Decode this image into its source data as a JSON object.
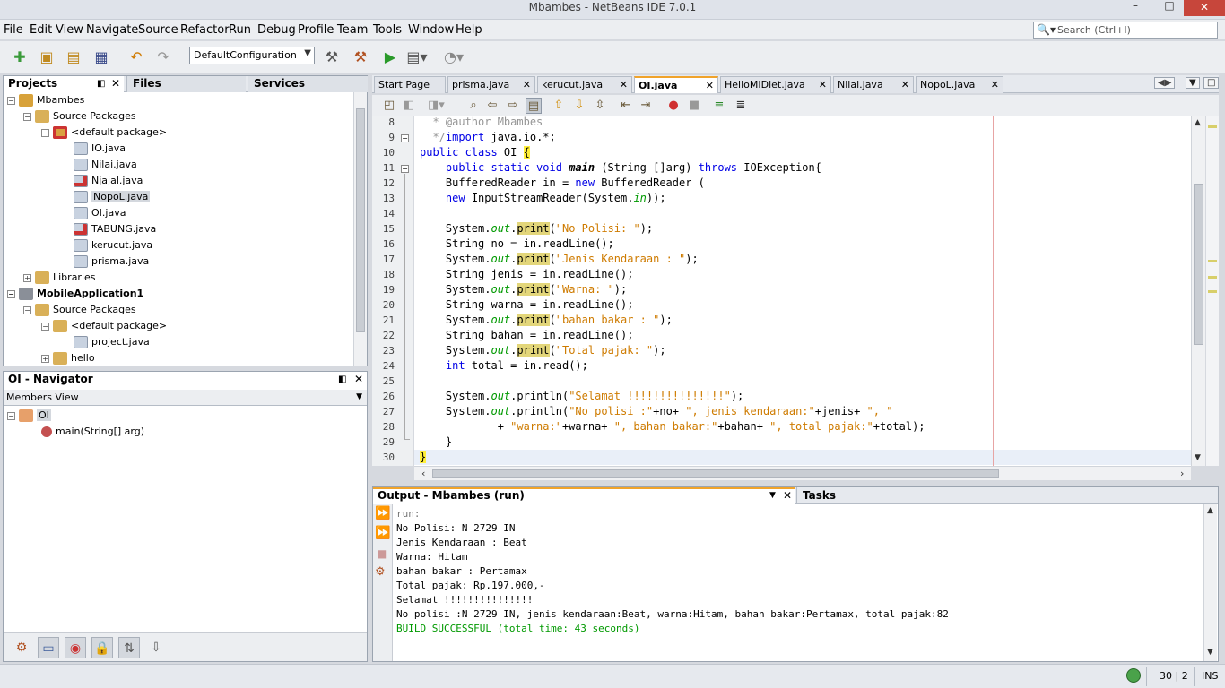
{
  "window": {
    "title": "Mbambes - NetBeans IDE 7.0.1"
  },
  "menu": [
    "File",
    "Edit",
    "View",
    "Navigate",
    "Source",
    "Refactor",
    "Run",
    "Debug",
    "Profile",
    "Team",
    "Tools",
    "Window",
    "Help"
  ],
  "search": {
    "placeholder": "Search (Ctrl+I)"
  },
  "toolbar": {
    "config": "DefaultConfiguration"
  },
  "projects_panel": {
    "tabs": [
      "Projects",
      "Files",
      "Services"
    ],
    "tree": [
      {
        "label": "Mbambes",
        "depth": 0,
        "bold": false
      },
      {
        "label": "Source Packages",
        "depth": 1
      },
      {
        "label": "<default package>",
        "depth": 2
      },
      {
        "label": "IO.java",
        "depth": 3
      },
      {
        "label": "Nilai.java",
        "depth": 3
      },
      {
        "label": "Njajal.java",
        "depth": 3
      },
      {
        "label": "NopoL.java",
        "depth": 3
      },
      {
        "label": "OI.java",
        "depth": 3
      },
      {
        "label": "TABUNG.java",
        "depth": 3
      },
      {
        "label": "kerucut.java",
        "depth": 3
      },
      {
        "label": "prisma.java",
        "depth": 3
      },
      {
        "label": "Libraries",
        "depth": 1
      },
      {
        "label": "MobileApplication1",
        "depth": 0,
        "bold": true
      },
      {
        "label": "Source Packages",
        "depth": 1
      },
      {
        "label": "<default package>",
        "depth": 2
      },
      {
        "label": "project.java",
        "depth": 3
      },
      {
        "label": "hello",
        "depth": 2
      }
    ]
  },
  "navigator": {
    "title": "OI - Navigator",
    "view": "Members View",
    "class_name": "OI",
    "member": "main(String[] arg)"
  },
  "editor": {
    "tabs": [
      "Start Page",
      "prisma.java",
      "kerucut.java",
      "OI.java",
      "HelloMIDlet.java",
      "Nilai.java",
      "NopoL.java"
    ],
    "active_tab": "OI.java",
    "line_numbers": [
      "8",
      "9",
      "10",
      "11",
      "12",
      "13",
      "14",
      "15",
      "16",
      "17",
      "18",
      "19",
      "20",
      "21",
      "22",
      "23",
      "24",
      "25",
      "26",
      "27",
      "28",
      "29",
      "30"
    ]
  },
  "output": {
    "title": "Output - Mbambes (run)",
    "tasks_tab": "Tasks",
    "lines": [
      "run:",
      "No Polisi: N 2729 IN",
      "Jenis Kendaraan : Beat",
      "Warna: Hitam",
      "bahan bakar : Pertamax",
      "Total pajak: Rp.197.000,-",
      "Selamat !!!!!!!!!!!!!!!",
      "No polisi :N 2729 IN, jenis kendaraan:Beat, warna:Hitam, bahan bakar:Pertamax, total pajak:82",
      "BUILD SUCCESSFUL (total time: 43 seconds)"
    ]
  },
  "status": {
    "position": "30 | 2",
    "mode": "INS"
  }
}
